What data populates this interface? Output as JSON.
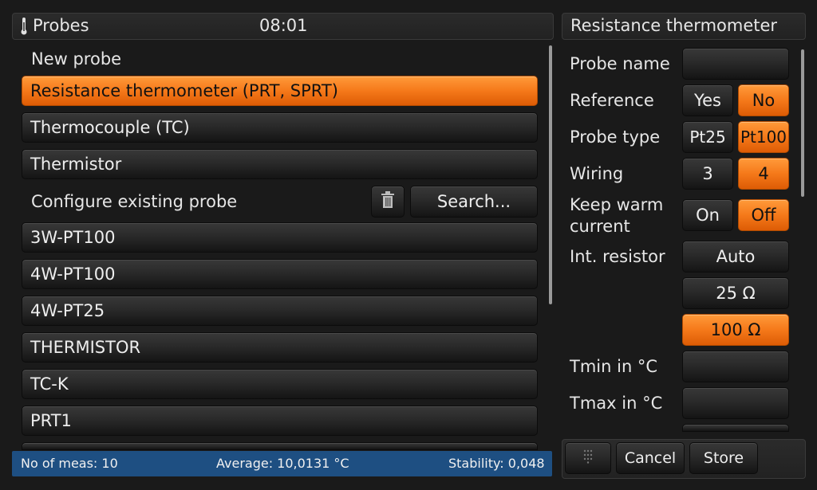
{
  "header": {
    "title": "Probes",
    "time": "08:01"
  },
  "right_header": {
    "title": "Resistance thermometer"
  },
  "left": {
    "new_probe_label": "New probe",
    "new_probe_types": [
      "Resistance thermometer (PRT, SPRT)",
      "Thermocouple (TC)",
      "Thermistor"
    ],
    "configure_label": "Configure existing probe",
    "search_label": "Search...",
    "existing_probes": [
      "3W-PT100",
      "4W-PT100",
      "4W-PT25",
      "THERMISTOR",
      "TC-K",
      "PRT1"
    ]
  },
  "settings": {
    "probe_name_label": "Probe name",
    "probe_name_value": "",
    "reference_label": "Reference",
    "reference_options": [
      "Yes",
      "No"
    ],
    "reference_selected": "No",
    "probe_type_label": "Probe type",
    "probe_type_options": [
      "Pt25",
      "Pt100"
    ],
    "probe_type_selected": "Pt100",
    "wiring_label": "Wiring",
    "wiring_options": [
      "3",
      "4"
    ],
    "wiring_selected": "4",
    "keep_warm_label_1": "Keep warm",
    "keep_warm_label_2": "current",
    "keep_warm_options": [
      "On",
      "Off"
    ],
    "keep_warm_selected": "Off",
    "int_resistor_label": "Int. resistor",
    "int_resistor_options": [
      "Auto",
      "25 Ω",
      "100 Ω"
    ],
    "int_resistor_selected": "100 Ω",
    "tmin_label": "Tmin in °C",
    "tmin_value": "",
    "tmax_label": "Tmax in °C",
    "tmax_value": ""
  },
  "status": {
    "meas": "No of meas: 10",
    "average": "Average: 10,0131 °C",
    "stability": "Stability: 0,048"
  },
  "actions": {
    "cancel": "Cancel",
    "store": "Store"
  },
  "colors": {
    "accent": "#f5791a",
    "status_bar": "#1e4f82"
  }
}
